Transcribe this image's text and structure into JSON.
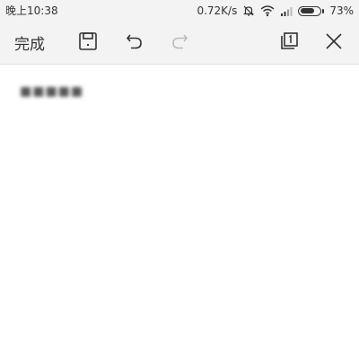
{
  "status_bar": {
    "time": "晚上10:38",
    "network_speed": "0.72K/s",
    "battery_percent": "73%",
    "battery_level": 0.73
  },
  "toolbar": {
    "done_label": "完成"
  },
  "content": {
    "text": "■■■■■"
  },
  "icons": {
    "save": "save-icon",
    "undo": "undo-icon",
    "redo": "redo-icon",
    "copy": "copy-icon",
    "close": "close-icon",
    "alarm": "alarm-off-icon",
    "wifi": "wifi-icon",
    "signal": "signal-icon",
    "battery": "battery-icon"
  },
  "colors": {
    "toolbar_bg": "#f3f3f3",
    "icon": "#333333",
    "icon_disabled": "#bbbbbb"
  }
}
